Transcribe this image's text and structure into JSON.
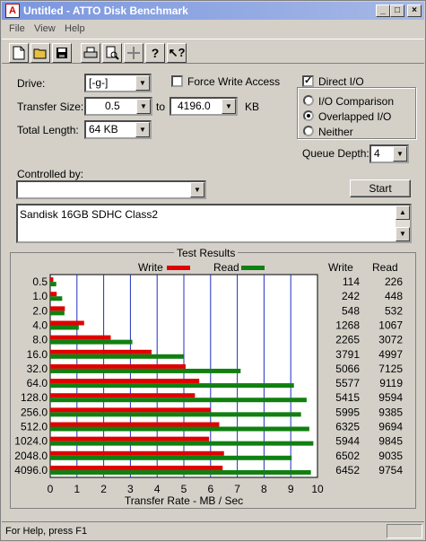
{
  "window": {
    "title": "Untitled - ATTO Disk Benchmark",
    "app_icon": "ATTO"
  },
  "title_buttons": {
    "minimize": "_",
    "maximize": "□",
    "close": "×"
  },
  "menu": [
    "File",
    "View",
    "Help"
  ],
  "toolbar": [
    "new-file-icon",
    "open-folder-icon",
    "save-icon",
    "print-icon",
    "print-preview-icon",
    "move-icon",
    "help-icon",
    "context-help-icon"
  ],
  "form": {
    "drive_label": "Drive:",
    "drive_value": "[-g-]",
    "transfer_size_label": "Transfer Size:",
    "transfer_from": "0.5",
    "to_label": "to",
    "transfer_to": "4196.0",
    "kb_label": "KB",
    "total_length_label": "Total Length:",
    "total_length_value": "64 KB",
    "force_write_label": "Force Write Access",
    "force_write_checked": false,
    "direct_io_label": "Direct I/O",
    "direct_io_checked": true,
    "radio_io_comparison": "I/O Comparison",
    "radio_overlapped": "Overlapped I/O",
    "radio_neither": "Neither",
    "selected_radio": "Overlapped I/O",
    "queue_depth_label": "Queue Depth:",
    "queue_depth_value": "4",
    "controlled_by_label": "Controlled by:",
    "controlled_by_value": "",
    "start_label": "Start",
    "description": "Sandisk 16GB SDHC Class2"
  },
  "results": {
    "title": "Test Results",
    "legend_write": "Write",
    "legend_read": "Read",
    "col_write": "Write",
    "col_read": "Read",
    "xlabel": "Transfer Rate - MB / Sec",
    "write_color": "#e00000",
    "read_color": "#108010"
  },
  "chart_data": {
    "type": "bar",
    "categories": [
      "0.5",
      "1.0",
      "2.0",
      "4.0",
      "8.0",
      "16.0",
      "32.0",
      "64.0",
      "128.0",
      "256.0",
      "512.0",
      "1024.0",
      "2048.0",
      "4096.0"
    ],
    "series": [
      {
        "name": "Write",
        "values": [
          114,
          242,
          548,
          1268,
          2265,
          3791,
          5066,
          5577,
          5415,
          5995,
          6325,
          5944,
          6502,
          6452
        ]
      },
      {
        "name": "Read",
        "values": [
          226,
          448,
          532,
          1067,
          3072,
          4997,
          7125,
          9119,
          9594,
          9385,
          9694,
          9845,
          9035,
          9754
        ]
      }
    ],
    "xticks": [
      "0",
      "1",
      "2",
      "3",
      "4",
      "5",
      "6",
      "7",
      "8",
      "9",
      "10"
    ],
    "xlim": [
      0,
      10
    ],
    "xlabel": "Transfer Rate - MB / Sec"
  },
  "status": {
    "text": "For Help, press F1"
  }
}
